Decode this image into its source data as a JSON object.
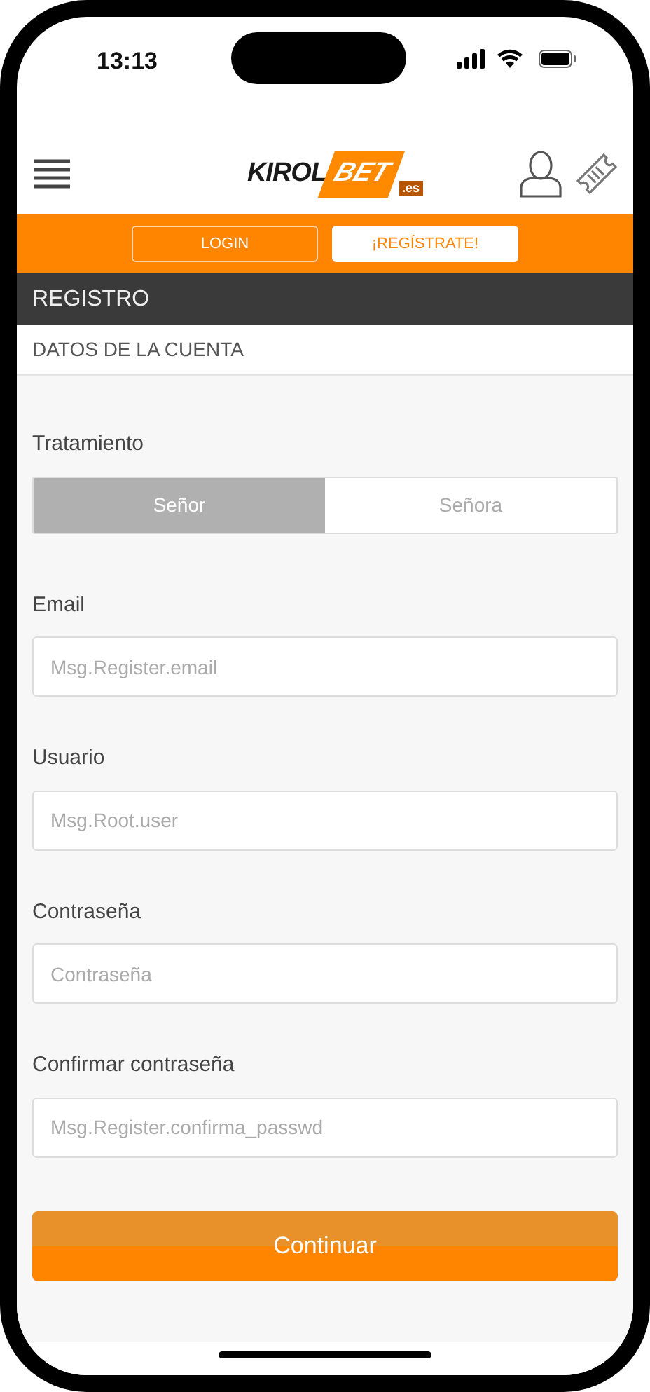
{
  "status_bar": {
    "time": "13:13"
  },
  "header": {
    "logo": {
      "text": "KIROL",
      "highlight": "BET",
      "suffix": ".es"
    }
  },
  "auth_bar": {
    "buttons": [
      {
        "label": "LOGIN",
        "kind": "outline"
      },
      {
        "label": "¡REGÍSTRATE!",
        "kind": "solid"
      }
    ]
  },
  "page_title": "REGISTRO",
  "section_title": "DATOS DE LA CUENTA",
  "form": {
    "fields": [
      {
        "kind": "segmented",
        "label": "Tratamiento",
        "options": [
          {
            "label": "Señor",
            "selected": true
          },
          {
            "label": "Señora",
            "selected": false
          }
        ]
      },
      {
        "kind": "input",
        "label": "Email",
        "placeholder": "Msg.Register.email"
      },
      {
        "kind": "input",
        "label": "Usuario",
        "placeholder": "Msg.Root.user"
      },
      {
        "kind": "input",
        "label": "Contraseña",
        "placeholder": "Contraseña"
      },
      {
        "kind": "input",
        "label": "Confirmar contraseña",
        "placeholder": "Msg.Register.confirma_passwd"
      }
    ],
    "submit": "Continuar"
  }
}
